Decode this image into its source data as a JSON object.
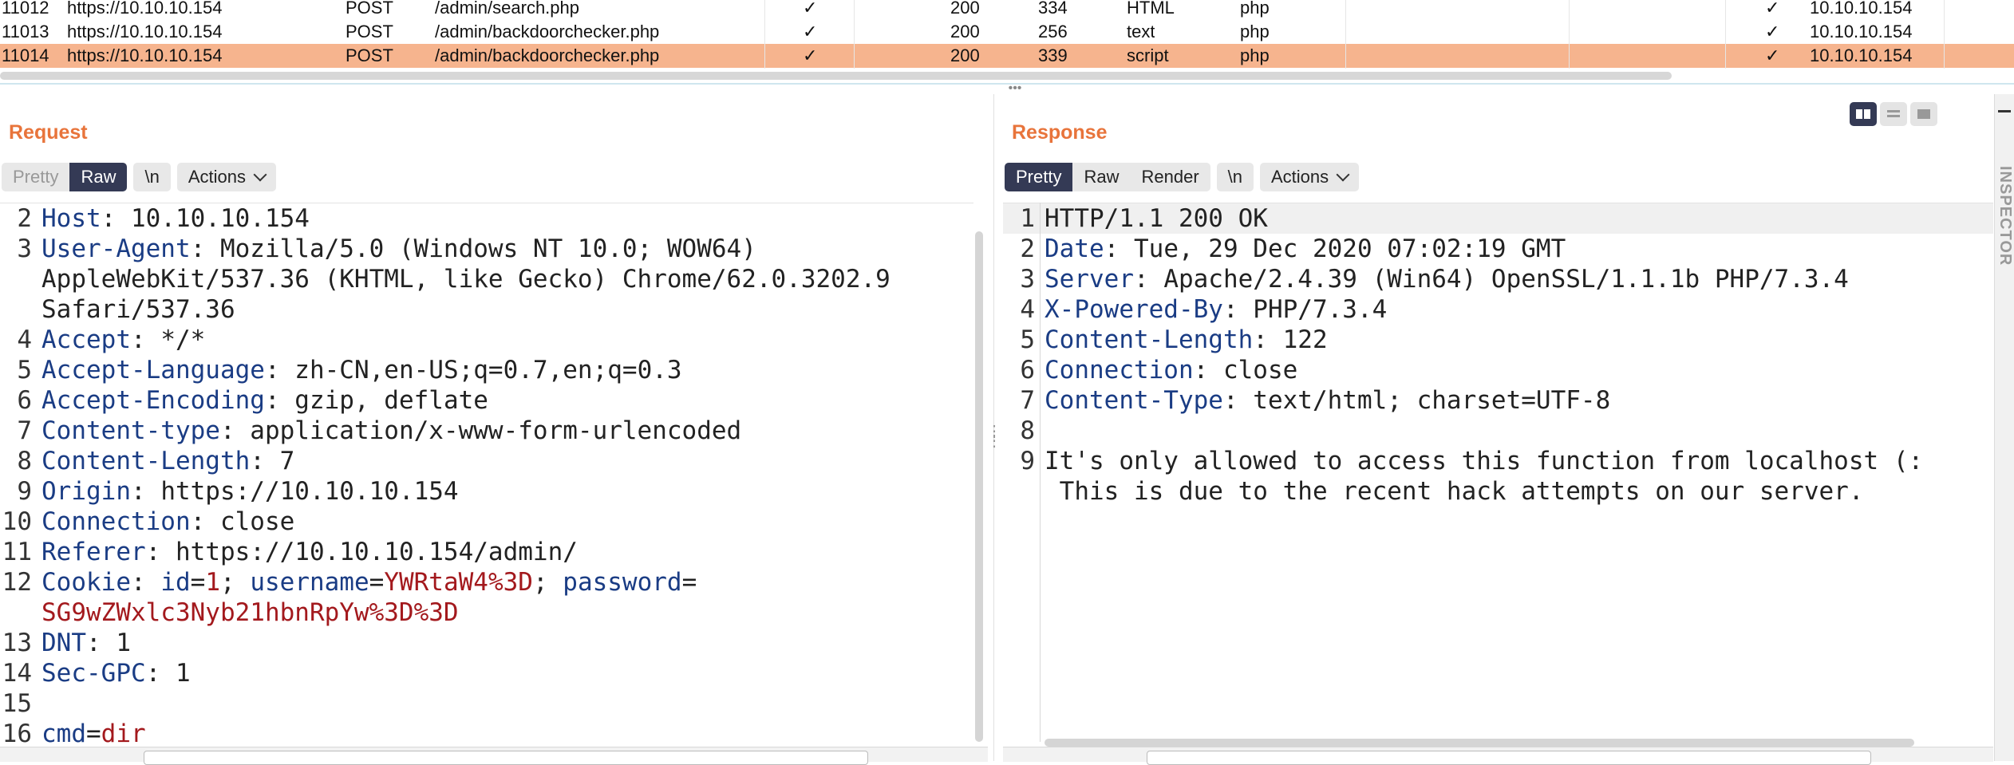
{
  "history": {
    "rows": [
      {
        "id": "11012",
        "host": "https://10.10.10.154",
        "method": "POST",
        "url": "/admin/search.php",
        "params": "✓",
        "status": "200",
        "length": "334",
        "mime": "HTML",
        "ext": "php",
        "tls": "✓",
        "ip": "10.10.10.154",
        "selected": false
      },
      {
        "id": "11013",
        "host": "https://10.10.10.154",
        "method": "POST",
        "url": "/admin/backdoorchecker.php",
        "params": "✓",
        "status": "200",
        "length": "256",
        "mime": "text",
        "ext": "php",
        "tls": "✓",
        "ip": "10.10.10.154",
        "selected": false
      },
      {
        "id": "11014",
        "host": "https://10.10.10.154",
        "method": "POST",
        "url": "/admin/backdoorchecker.php",
        "params": "✓",
        "status": "200",
        "length": "339",
        "mime": "script",
        "ext": "php",
        "tls": "✓",
        "ip": "10.10.10.154",
        "selected": true
      }
    ]
  },
  "request": {
    "title": "Request",
    "tabs": {
      "pretty": "Pretty",
      "raw": "Raw",
      "newline": "\\n",
      "actions": "Actions"
    },
    "lines": [
      {
        "n": "2",
        "key": "Host",
        "value": " 10.10.10.154"
      },
      {
        "n": "3",
        "key": "User-Agent",
        "value": " Mozilla/5.0 (Windows NT 10.0; WOW64) AppleWebKit/537.36 (KHTML, like Gecko) Chrome/62.0.3202.9 Safari/537.36"
      },
      {
        "n": "4",
        "key": "Accept",
        "value": " */*"
      },
      {
        "n": "5",
        "key": "Accept-Language",
        "value": " zh-CN,en-US;q=0.7,en;q=0.3"
      },
      {
        "n": "6",
        "key": "Accept-Encoding",
        "value": " gzip, deflate"
      },
      {
        "n": "7",
        "key": "Content-type",
        "value": " application/x-www-form-urlencoded"
      },
      {
        "n": "8",
        "key": "Content-Length",
        "value": " 7"
      },
      {
        "n": "9",
        "key": "Origin",
        "value": " https://10.10.10.154"
      },
      {
        "n": "10",
        "key": "Connection",
        "value": " close"
      },
      {
        "n": "11",
        "key": "Referer",
        "value": " https://10.10.10.154/admin/"
      },
      {
        "n": "12",
        "key": "Cookie",
        "value": " ",
        "cookie": {
          "k1": "id",
          "v1": "1",
          "k2": "username",
          "v2": "YWRtaW4%3D",
          "k3": "password",
          "v3": "SG9wZWxlc3Nyb21hbnRpYw%3D%3D"
        }
      },
      {
        "n": "13",
        "key": "DNT",
        "value": " 1"
      },
      {
        "n": "14",
        "key": "Sec-GPC",
        "value": " 1"
      },
      {
        "n": "15",
        "key": "",
        "value": ""
      },
      {
        "n": "16",
        "key": "",
        "value": "",
        "body": {
          "k": "cmd",
          "v": "dir"
        }
      }
    ]
  },
  "response": {
    "title": "Response",
    "tabs": {
      "pretty": "Pretty",
      "raw": "Raw",
      "render": "Render",
      "newline": "\\n",
      "actions": "Actions"
    },
    "lines": [
      {
        "n": "1",
        "key": "",
        "value": "HTTP/1.1 200 OK"
      },
      {
        "n": "2",
        "key": "Date",
        "value": " Tue, 29 Dec 2020 07:02:19 GMT"
      },
      {
        "n": "3",
        "key": "Server",
        "value": " Apache/2.4.39 (Win64) OpenSSL/1.1.1b PHP/7.3.4"
      },
      {
        "n": "4",
        "key": "X-Powered-By",
        "value": " PHP/7.3.4"
      },
      {
        "n": "5",
        "key": "Content-Length",
        "value": " 122"
      },
      {
        "n": "6",
        "key": "Connection",
        "value": " close"
      },
      {
        "n": "7",
        "key": "Content-Type",
        "value": " text/html; charset=UTF-8"
      },
      {
        "n": "8",
        "key": "",
        "value": ""
      },
      {
        "n": "9",
        "key": "",
        "value": "It's only allowed to access this function from localhost (:\n This is due to the recent hack attempts on our server."
      }
    ]
  },
  "inspector": {
    "label": "INSPECTOR"
  }
}
